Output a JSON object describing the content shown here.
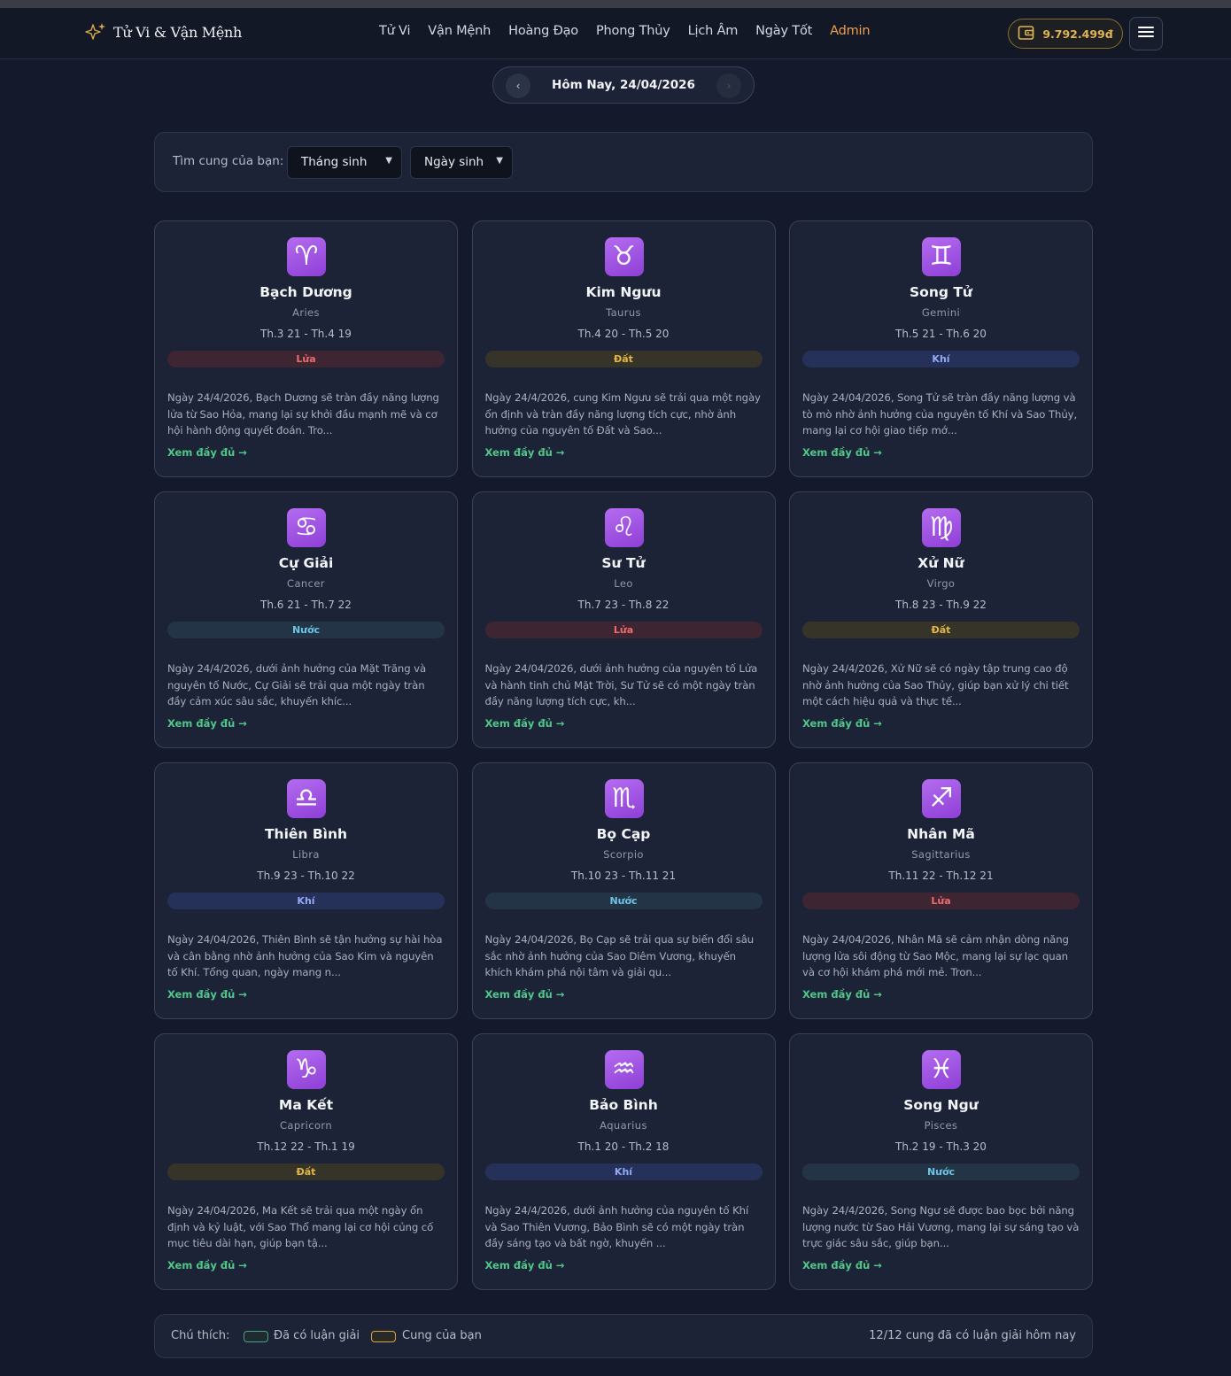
{
  "brand": {
    "name": "Tử Vi & Vận Mệnh",
    "icon": "sparkle-icon"
  },
  "nav": {
    "links": [
      "Tử Vi",
      "Vận Mệnh",
      "Hoàng Đạo",
      "Phong Thủy",
      "Lịch Âm",
      "Ngày Tốt"
    ],
    "admin": "Admin"
  },
  "wallet": {
    "balance": "9.792.499đ",
    "icon": "wallet-icon"
  },
  "menu": {
    "icon": "hamburger-icon"
  },
  "date_nav": {
    "label": "Hôm Nay, 24/04/2026",
    "prev": "‹",
    "next": "›"
  },
  "filter": {
    "label": "Tìm cung của bạn:",
    "month": "Tháng sinh",
    "day": "Ngày sinh",
    "caret": "▼"
  },
  "signs": [
    {
      "symbol": "♈",
      "name": "Bạch Dương",
      "en": "Aries",
      "range": "Th.3 21 - Th.4 19",
      "element": "Lửa",
      "element_key": "lua",
      "reading": "Ngày 24/4/2026, Bạch Dương sẽ tràn đầy năng lượng lửa từ Sao Hỏa, mang lại sự khởi đầu mạnh mẽ và cơ hội hành động quyết đoán. Tro...",
      "more": "Xem đầy đủ →"
    },
    {
      "symbol": "♉",
      "name": "Kim Ngưu",
      "en": "Taurus",
      "range": "Th.4 20 - Th.5 20",
      "element": "Đất",
      "element_key": "dat",
      "reading": "Ngày 24/4/2026, cung Kim Ngưu sẽ trải qua một ngày ổn định và tràn đầy năng lượng tích cực, nhờ ảnh hưởng của nguyên tố Đất và Sao...",
      "more": "Xem đầy đủ →"
    },
    {
      "symbol": "♊",
      "name": "Song Tử",
      "en": "Gemini",
      "range": "Th.5 21 - Th.6 20",
      "element": "Khí",
      "element_key": "khi",
      "reading": "Ngày 24/04/2026, Song Tử sẽ tràn đầy năng lượng và tò mò nhờ ảnh hưởng của nguyên tố Khí và Sao Thủy, mang lại cơ hội giao tiếp mớ...",
      "more": "Xem đầy đủ →"
    },
    {
      "symbol": "♋",
      "name": "Cự Giải",
      "en": "Cancer",
      "range": "Th.6 21 - Th.7 22",
      "element": "Nước",
      "element_key": "nuoc",
      "reading": "Ngày 24/4/2026, dưới ảnh hưởng của Mặt Trăng và nguyên tố Nước, Cự Giải sẽ trải qua một ngày tràn đầy cảm xúc sâu sắc, khuyến khíc...",
      "more": "Xem đầy đủ →"
    },
    {
      "symbol": "♌",
      "name": "Sư Tử",
      "en": "Leo",
      "range": "Th.7 23 - Th.8 22",
      "element": "Lửa",
      "element_key": "lua",
      "reading": "Ngày 24/04/2026, dưới ảnh hưởng của nguyên tố Lửa và hành tinh chủ Mặt Trời, Sư Tử sẽ có một ngày tràn đầy năng lượng tích cực, kh...",
      "more": "Xem đầy đủ →"
    },
    {
      "symbol": "♍",
      "name": "Xử Nữ",
      "en": "Virgo",
      "range": "Th.8 23 - Th.9 22",
      "element": "Đất",
      "element_key": "dat",
      "reading": "Ngày 24/4/2026, Xử Nữ sẽ có ngày tập trung cao độ nhờ ảnh hưởng của Sao Thủy, giúp bạn xử lý chi tiết một cách hiệu quả và thực tế...",
      "more": "Xem đầy đủ →"
    },
    {
      "symbol": "♎",
      "name": "Thiên Bình",
      "en": "Libra",
      "range": "Th.9 23 - Th.10 22",
      "element": "Khí",
      "element_key": "khi",
      "reading": "Ngày 24/04/2026, Thiên Bình sẽ tận hưởng sự hài hòa và cân bằng nhờ ảnh hưởng của Sao Kim và nguyên tố Khí. Tổng quan, ngày mang n...",
      "more": "Xem đầy đủ →"
    },
    {
      "symbol": "♏",
      "name": "Bọ Cạp",
      "en": "Scorpio",
      "range": "Th.10 23 - Th.11 21",
      "element": "Nước",
      "element_key": "nuoc",
      "reading": "Ngày 24/04/2026, Bọ Cạp sẽ trải qua sự biến đổi sâu sắc nhờ ảnh hưởng của Sao Diêm Vương, khuyến khích khám phá nội tâm và giải qu...",
      "more": "Xem đầy đủ →"
    },
    {
      "symbol": "♐",
      "name": "Nhân Mã",
      "en": "Sagittarius",
      "range": "Th.11 22 - Th.12 21",
      "element": "Lửa",
      "element_key": "lua",
      "reading": "Ngày 24/04/2026, Nhân Mã sẽ cảm nhận dòng năng lượng lửa sôi động từ Sao Mộc, mang lại sự lạc quan và cơ hội khám phá mới mẻ. Tron...",
      "more": "Xem đầy đủ →"
    },
    {
      "symbol": "♑",
      "name": "Ma Kết",
      "en": "Capricorn",
      "range": "Th.12 22 - Th.1 19",
      "element": "Đất",
      "element_key": "dat",
      "reading": "Ngày 24/04/2026, Ma Kết sẽ trải qua một ngày ổn định và kỷ luật, với Sao Thổ mang lại cơ hội củng cố mục tiêu dài hạn, giúp bạn tậ...",
      "more": "Xem đầy đủ →"
    },
    {
      "symbol": "♒",
      "name": "Bảo Bình",
      "en": "Aquarius",
      "range": "Th.1 20 - Th.2 18",
      "element": "Khí",
      "element_key": "khi",
      "reading": "Ngày 24/4/2026, dưới ảnh hưởng của nguyên tố Khí và Sao Thiên Vương, Bảo Bình sẽ có một ngày tràn đầy sáng tạo và bất ngờ, khuyến ...",
      "more": "Xem đầy đủ →"
    },
    {
      "symbol": "♓",
      "name": "Song Ngư",
      "en": "Pisces",
      "range": "Th.2 19 - Th.3 20",
      "element": "Nước",
      "element_key": "nuoc",
      "reading": "Ngày 24/4/2026, Song Ngư sẽ được bao bọc bởi năng lượng nước từ Sao Hải Vương, mang lại sự sáng tạo và trực giác sâu sắc, giúp bạn...",
      "more": "Xem đầy đủ →"
    }
  ],
  "legend": {
    "label": "Chú thích:",
    "done": "Đã có luận giải",
    "mine": "Cung của bạn",
    "summary": "12/12 cung đã có luận giải hôm nay"
  },
  "colors": {
    "background": "#141a2b",
    "card": "#1c2336",
    "accent_link": "#4fc88a",
    "admin": "#f0a04b",
    "wallet": "#e0b453",
    "icon_purple": "#a857e8"
  }
}
